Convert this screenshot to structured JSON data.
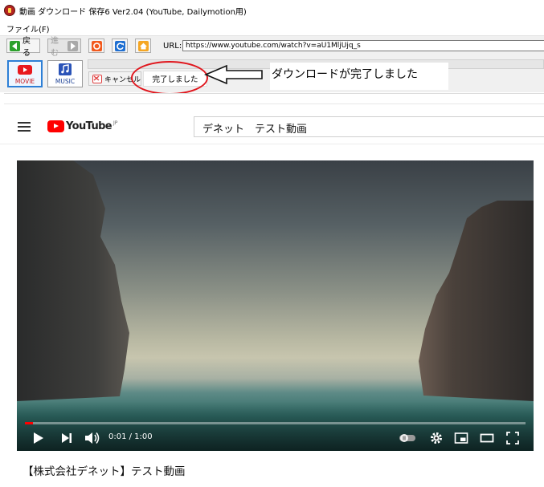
{
  "window": {
    "title": "動画 ダウンロード 保存6 Ver2.04 (YouTube, Dailymotion用)"
  },
  "menu": {
    "file": "ファイル(F)"
  },
  "toolbar": {
    "back_label": "戻る",
    "forward_label": "進む",
    "url_label": "URL:",
    "url_value": "https://www.youtube.com/watch?v=aU1MljUjq_s"
  },
  "modes": {
    "movie_label": "MOVIE",
    "music_label": "MUSIC"
  },
  "download": {
    "cancel_label": "キャンセル",
    "status_text": "完了しました"
  },
  "annotation": {
    "callout_text": "ダウンロードが完了しました"
  },
  "youtube": {
    "logo_text": "YouTube",
    "logo_region": "JP",
    "search_value": "デネット　テスト動画",
    "video_time": "0:01 / 1:00",
    "video_progress": 0.0167,
    "video_title": "【株式会社デネット】テスト動画"
  },
  "colors": {
    "accent_red": "#ff0000",
    "annotation_red": "#e0161d",
    "movie_selected": "#2d7fd6"
  }
}
